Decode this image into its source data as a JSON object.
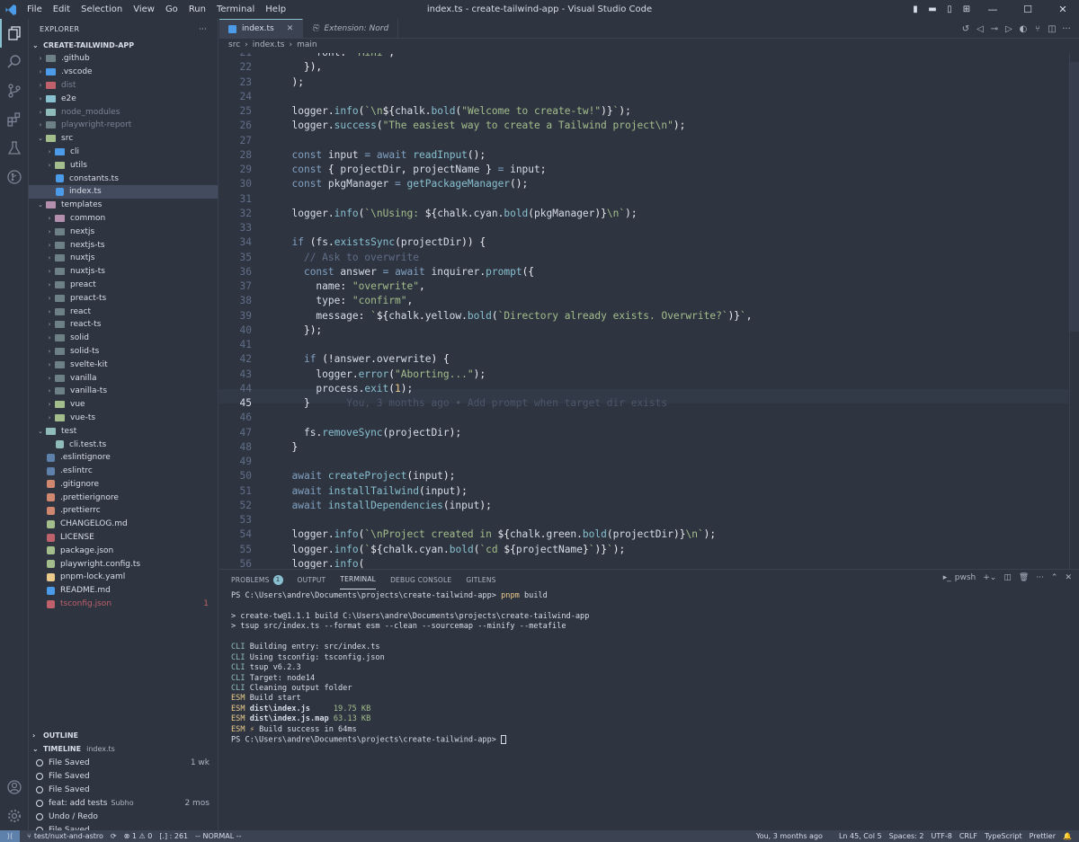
{
  "titlebar": {
    "menu": [
      "File",
      "Edit",
      "Selection",
      "View",
      "Go",
      "Run",
      "Terminal",
      "Help"
    ],
    "title": "index.ts - create-tailwind-app - Visual Studio Code"
  },
  "explorer": {
    "title": "EXPLORER",
    "project": "CREATE-TAILWIND-APP",
    "items": [
      {
        "label": ".github",
        "depth": 1,
        "type": "folder",
        "color": "#6d8086",
        "state": "closed"
      },
      {
        "label": ".vscode",
        "depth": 1,
        "type": "folder",
        "color": "#4c9be8",
        "state": "closed"
      },
      {
        "label": "dist",
        "depth": 1,
        "type": "folder",
        "color": "#bf616a",
        "state": "closed",
        "dim": true
      },
      {
        "label": "e2e",
        "depth": 1,
        "type": "folder",
        "color": "#88c0d0",
        "state": "closed"
      },
      {
        "label": "node_modules",
        "depth": 1,
        "type": "folder",
        "color": "#8fbcbb",
        "state": "closed",
        "dim": true
      },
      {
        "label": "playwright-report",
        "depth": 1,
        "type": "folder",
        "color": "#6d8086",
        "state": "closed",
        "dim": true
      },
      {
        "label": "src",
        "depth": 1,
        "type": "folder",
        "color": "#a3be8c",
        "state": "open"
      },
      {
        "label": "cli",
        "depth": 2,
        "type": "folder",
        "color": "#4c9be8",
        "state": "closed"
      },
      {
        "label": "utils",
        "depth": 2,
        "type": "folder",
        "color": "#a3be8c",
        "state": "closed"
      },
      {
        "label": "constants.ts",
        "depth": 2,
        "type": "file",
        "color": "#4c9be8"
      },
      {
        "label": "index.ts",
        "depth": 2,
        "type": "file",
        "color": "#4c9be8",
        "selected": true
      },
      {
        "label": "templates",
        "depth": 1,
        "type": "folder",
        "color": "#b48ead",
        "state": "open"
      },
      {
        "label": "common",
        "depth": 2,
        "type": "folder",
        "color": "#b48ead",
        "state": "closed"
      },
      {
        "label": "nextjs",
        "depth": 2,
        "type": "folder",
        "color": "#6d8086",
        "state": "closed"
      },
      {
        "label": "nextjs-ts",
        "depth": 2,
        "type": "folder",
        "color": "#6d8086",
        "state": "closed"
      },
      {
        "label": "nuxtjs",
        "depth": 2,
        "type": "folder",
        "color": "#6d8086",
        "state": "closed"
      },
      {
        "label": "nuxtjs-ts",
        "depth": 2,
        "type": "folder",
        "color": "#6d8086",
        "state": "closed"
      },
      {
        "label": "preact",
        "depth": 2,
        "type": "folder",
        "color": "#6d8086",
        "state": "closed"
      },
      {
        "label": "preact-ts",
        "depth": 2,
        "type": "folder",
        "color": "#6d8086",
        "state": "closed"
      },
      {
        "label": "react",
        "depth": 2,
        "type": "folder",
        "color": "#6d8086",
        "state": "closed"
      },
      {
        "label": "react-ts",
        "depth": 2,
        "type": "folder",
        "color": "#6d8086",
        "state": "closed"
      },
      {
        "label": "solid",
        "depth": 2,
        "type": "folder",
        "color": "#6d8086",
        "state": "closed"
      },
      {
        "label": "solid-ts",
        "depth": 2,
        "type": "folder",
        "color": "#6d8086",
        "state": "closed"
      },
      {
        "label": "svelte-kit",
        "depth": 2,
        "type": "folder",
        "color": "#6d8086",
        "state": "closed"
      },
      {
        "label": "vanilla",
        "depth": 2,
        "type": "folder",
        "color": "#6d8086",
        "state": "closed"
      },
      {
        "label": "vanilla-ts",
        "depth": 2,
        "type": "folder",
        "color": "#6d8086",
        "state": "closed"
      },
      {
        "label": "vue",
        "depth": 2,
        "type": "folder",
        "color": "#a3be8c",
        "state": "closed"
      },
      {
        "label": "vue-ts",
        "depth": 2,
        "type": "folder",
        "color": "#a3be8c",
        "state": "closed"
      },
      {
        "label": "test",
        "depth": 1,
        "type": "folder",
        "color": "#8fbcbb",
        "state": "open"
      },
      {
        "label": "cli.test.ts",
        "depth": 2,
        "type": "file",
        "color": "#8fbcbb"
      },
      {
        "label": ".eslintignore",
        "depth": 1,
        "type": "file",
        "color": "#5e81ac"
      },
      {
        "label": ".eslintrc",
        "depth": 1,
        "type": "file",
        "color": "#5e81ac"
      },
      {
        "label": ".gitignore",
        "depth": 1,
        "type": "file",
        "color": "#d08770"
      },
      {
        "label": ".prettierignore",
        "depth": 1,
        "type": "file",
        "color": "#d08770"
      },
      {
        "label": ".prettierrc",
        "depth": 1,
        "type": "file",
        "color": "#d08770"
      },
      {
        "label": "CHANGELOG.md",
        "depth": 1,
        "type": "file",
        "color": "#a3be8c"
      },
      {
        "label": "LICENSE",
        "depth": 1,
        "type": "file",
        "color": "#bf616a"
      },
      {
        "label": "package.json",
        "depth": 1,
        "type": "file",
        "color": "#a3be8c"
      },
      {
        "label": "playwright.config.ts",
        "depth": 1,
        "type": "file",
        "color": "#a3be8c"
      },
      {
        "label": "pnpm-lock.yaml",
        "depth": 1,
        "type": "file",
        "color": "#ebcb8b"
      },
      {
        "label": "README.md",
        "depth": 1,
        "type": "file",
        "color": "#4c9be8"
      },
      {
        "label": "tsconfig.json",
        "depth": 1,
        "type": "file",
        "color": "#bf616a",
        "red": true,
        "badge": "1"
      }
    ]
  },
  "outline": {
    "title": "OUTLINE"
  },
  "timeline": {
    "title": "TIMELINE",
    "file": "index.ts",
    "items": [
      {
        "label": "File Saved",
        "sub": "",
        "time": "1 wk"
      },
      {
        "label": "File Saved",
        "sub": "",
        "time": ""
      },
      {
        "label": "File Saved",
        "sub": "",
        "time": ""
      },
      {
        "label": "feat: add tests",
        "sub": "Subho",
        "time": "2 mos"
      },
      {
        "label": "Undo / Redo",
        "sub": "",
        "time": ""
      },
      {
        "label": "File Saved",
        "sub": "",
        "time": ""
      }
    ]
  },
  "tabs": [
    {
      "label": "index.ts",
      "active": true
    },
    {
      "label": "Extension: Nord",
      "active": false
    }
  ],
  "breadcrumb": [
    "src",
    "›",
    "index.ts",
    "›",
    "main"
  ],
  "code": {
    "lines": [
      {
        "n": "21",
        "html": "      <span class='v'>font</span><span class='p'>: </span><span class='s'>\"Mini\"</span><span class='p'>,</span>"
      },
      {
        "n": "22",
        "html": "    <span class='p'>}),</span>"
      },
      {
        "n": "23",
        "html": "  <span class='p'>);</span>"
      },
      {
        "n": "24",
        "html": ""
      },
      {
        "n": "25",
        "html": "  <span class='v'>logger</span><span class='p'>.</span><span class='f'>info</span><span class='p'>(</span><span class='s'>`\\n</span><span class='p'>${</span><span class='v'>chalk</span><span class='p'>.</span><span class='f'>bold</span><span class='p'>(</span><span class='s'>\"Welcome to create-tw!\"</span><span class='p'>)}</span><span class='s'>`</span><span class='p'>);</span>"
      },
      {
        "n": "26",
        "html": "  <span class='v'>logger</span><span class='p'>.</span><span class='f'>success</span><span class='p'>(</span><span class='s'>\"The easiest way to create a Tailwind project\\n\"</span><span class='p'>);</span>"
      },
      {
        "n": "27",
        "html": ""
      },
      {
        "n": "28",
        "html": "  <span class='k'>const</span> <span class='v'>input</span> <span class='k'>=</span> <span class='k'>await</span> <span class='f'>readInput</span><span class='p'>();</span>"
      },
      {
        "n": "29",
        "html": "  <span class='k'>const</span> <span class='p'>{ </span><span class='v'>projectDir</span><span class='p'>, </span><span class='v'>projectName</span><span class='p'> }</span> <span class='k'>=</span> <span class='v'>input</span><span class='p'>;</span>"
      },
      {
        "n": "30",
        "html": "  <span class='k'>const</span> <span class='v'>pkgManager</span> <span class='k'>=</span> <span class='f'>getPackageManager</span><span class='p'>();</span>"
      },
      {
        "n": "31",
        "html": ""
      },
      {
        "n": "32",
        "html": "  <span class='v'>logger</span><span class='p'>.</span><span class='f'>info</span><span class='p'>(</span><span class='s'>`\\nUsing: </span><span class='p'>${</span><span class='v'>chalk</span><span class='p'>.</span><span class='v'>cyan</span><span class='p'>.</span><span class='f'>bold</span><span class='p'>(</span><span class='v'>pkgManager</span><span class='p'>)}</span><span class='s'>\\n`</span><span class='p'>);</span>"
      },
      {
        "n": "33",
        "html": ""
      },
      {
        "n": "34",
        "html": "  <span class='k'>if</span> <span class='p'>(</span><span class='v'>fs</span><span class='p'>.</span><span class='f'>existsSync</span><span class='p'>(</span><span class='v'>projectDir</span><span class='p'>)) {</span>"
      },
      {
        "n": "35",
        "html": "    <span class='c'>// Ask to overwrite</span>"
      },
      {
        "n": "36",
        "html": "    <span class='k'>const</span> <span class='v'>answer</span> <span class='k'>=</span> <span class='k'>await</span> <span class='v'>inquirer</span><span class='p'>.</span><span class='f'>prompt</span><span class='p'>({</span>"
      },
      {
        "n": "37",
        "html": "      <span class='v'>name</span><span class='p'>: </span><span class='s'>\"overwrite\"</span><span class='p'>,</span>"
      },
      {
        "n": "38",
        "html": "      <span class='v'>type</span><span class='p'>: </span><span class='s'>\"confirm\"</span><span class='p'>,</span>"
      },
      {
        "n": "39",
        "html": "      <span class='v'>message</span><span class='p'>: </span><span class='s'>`</span><span class='p'>${</span><span class='v'>chalk</span><span class='p'>.</span><span class='v'>yellow</span><span class='p'>.</span><span class='f'>bold</span><span class='p'>(</span><span class='s'>`Directory already exists. Overwrite?`</span><span class='p'>)}</span><span class='s'>`</span><span class='p'>,</span>"
      },
      {
        "n": "40",
        "html": "    <span class='p'>});</span>"
      },
      {
        "n": "41",
        "html": ""
      },
      {
        "n": "42",
        "html": "    <span class='k'>if</span> <span class='p'>(!</span><span class='v'>answer</span><span class='p'>.</span><span class='v'>overwrite</span><span class='p'>) {</span>"
      },
      {
        "n": "43",
        "html": "      <span class='v'>logger</span><span class='p'>.</span><span class='f'>error</span><span class='p'>(</span><span class='s'>\"Aborting...\"</span><span class='p'>);</span>"
      },
      {
        "n": "44",
        "html": "      <span class='v'>process</span><span class='p'>.</span><span class='f'>exit</span><span class='p'>(</span><span class='y'>1</span><span class='p'>);</span>"
      },
      {
        "n": "45",
        "html": "    <span class='p'>}</span>      <span class='blame'>You, 3 months ago • Add prompt when target dir exists</span>",
        "cur": true
      },
      {
        "n": "46",
        "html": ""
      },
      {
        "n": "47",
        "html": "    <span class='v'>fs</span><span class='p'>.</span><span class='f'>removeSync</span><span class='p'>(</span><span class='v'>projectDir</span><span class='p'>);</span>"
      },
      {
        "n": "48",
        "html": "  <span class='p'>}</span>"
      },
      {
        "n": "49",
        "html": ""
      },
      {
        "n": "50",
        "html": "  <span class='k'>await</span> <span class='f'>createProject</span><span class='p'>(</span><span class='v'>input</span><span class='p'>);</span>"
      },
      {
        "n": "51",
        "html": "  <span class='k'>await</span> <span class='f'>installTailwind</span><span class='p'>(</span><span class='v'>input</span><span class='p'>);</span>"
      },
      {
        "n": "52",
        "html": "  <span class='k'>await</span> <span class='f'>installDependencies</span><span class='p'>(</span><span class='v'>input</span><span class='p'>);</span>"
      },
      {
        "n": "53",
        "html": ""
      },
      {
        "n": "54",
        "html": "  <span class='v'>logger</span><span class='p'>.</span><span class='f'>info</span><span class='p'>(</span><span class='s'>`\\nProject created in </span><span class='p'>${</span><span class='v'>chalk</span><span class='p'>.</span><span class='v'>green</span><span class='p'>.</span><span class='f'>bold</span><span class='p'>(</span><span class='v'>projectDir</span><span class='p'>)}</span><span class='s'>\\n`</span><span class='p'>);</span>"
      },
      {
        "n": "55",
        "html": "  <span class='v'>logger</span><span class='p'>.</span><span class='f'>info</span><span class='p'>(</span><span class='s'>`</span><span class='p'>${</span><span class='v'>chalk</span><span class='p'>.</span><span class='v'>cyan</span><span class='p'>.</span><span class='f'>bold</span><span class='p'>(</span><span class='s'>`cd </span><span class='p'>${</span><span class='v'>projectName</span><span class='p'>}</span><span class='s'>`</span><span class='p'>)}</span><span class='s'>`</span><span class='p'>);</span>"
      },
      {
        "n": "56",
        "html": "  <span class='v'>logger</span><span class='p'>.</span><span class='f'>info</span><span class='p'>(</span>"
      }
    ]
  },
  "panel": {
    "tabs": [
      {
        "label": "PROBLEMS",
        "badge": "1"
      },
      {
        "label": "OUTPUT"
      },
      {
        "label": "TERMINAL",
        "active": true
      },
      {
        "label": "DEBUG CONSOLE"
      },
      {
        "label": "GITLENS"
      }
    ],
    "shell": "pwsh",
    "terminal": [
      {
        "html": "PS C:\\Users\\andre\\Documents\\projects\\create-tailwind-app> <span class='y'>pnpm</span> build"
      },
      {
        "html": ""
      },
      {
        "html": "&gt; create-tw@1.1.1 build C:\\Users\\andre\\Documents\\projects\\create-tailwind-app"
      },
      {
        "html": "&gt; tsup src/index.ts --format esm --clean --sourcemap --minify --metafile"
      },
      {
        "html": ""
      },
      {
        "html": "<span class='tag-c'>CLI</span> Building entry: src/index.ts"
      },
      {
        "html": "<span class='tag-c'>CLI</span> Using tsconfig: tsconfig.json"
      },
      {
        "html": "<span class='tag-c'>CLI</span> tsup v6.2.3"
      },
      {
        "html": "<span class='tag-c'>CLI</span> Target: node14"
      },
      {
        "html": "<span class='tag-c'>CLI</span> Cleaning output folder"
      },
      {
        "html": "<span class='tag-e'>ESM</span> Build start"
      },
      {
        "html": "<span class='tag-e'>ESM</span> <span class='b'>dist\\index.js</span>     <span class='g'>19.75 KB</span>"
      },
      {
        "html": "<span class='tag-e'>ESM</span> <span class='b'>dist\\index.js.map</span> <span class='g'>63.13 KB</span>"
      },
      {
        "html": "<span class='tag-e'>ESM</span> <span class='y'>⚡</span> Build success in 64ms"
      },
      {
        "html": "PS C:\\Users\\andre\\Documents\\projects\\create-tailwind-app> <span class='cursor'></span>"
      }
    ]
  },
  "statusbar": {
    "branch": "test/nuxt-and-astro",
    "errors": "⊗ 1 ⚠ 0",
    "selection": "[.] : 261",
    "mode": "-- NORMAL --",
    "blame": "You, 3 months ago",
    "position": "Ln 45, Col 5",
    "spaces": "Spaces: 2",
    "encoding": "UTF-8",
    "eol": "CRLF",
    "language": "TypeScript",
    "prettier": "Prettier"
  }
}
